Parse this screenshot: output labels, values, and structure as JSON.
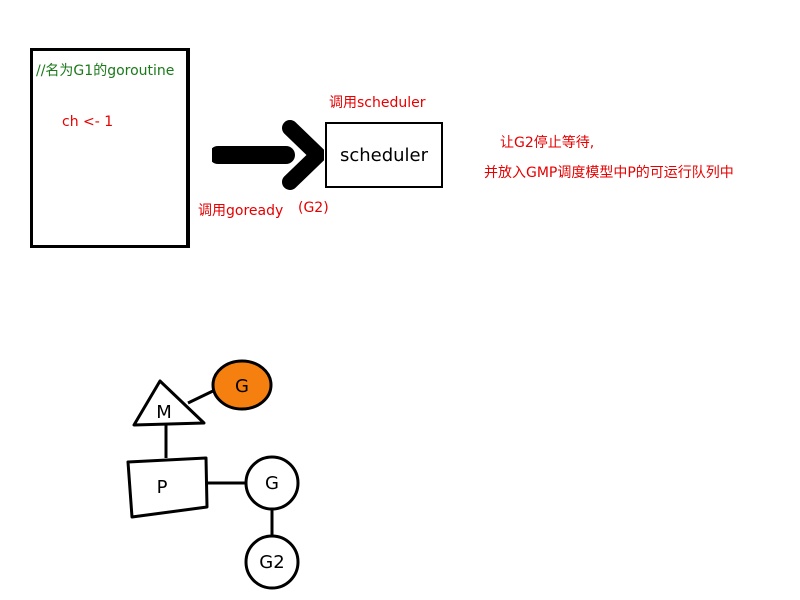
{
  "goroutine_box": {
    "comment": "//名为G1的goroutine",
    "code": "ch <- 1"
  },
  "call_scheduler_label": "调用scheduler",
  "scheduler_box_label": "scheduler",
  "call_goready_label": "调用goready",
  "goready_arg": "(G2)",
  "note": {
    "line1": "让G2停止等待,",
    "line2": "并放入GMP调度模型中P的可运行队列中"
  },
  "gmp": {
    "m_label": "M",
    "running_g_label": "G",
    "p_label": "P",
    "queued_g_label": "G",
    "g2_label": "G2",
    "running_g_color": "#f5800f",
    "stroke_color": "#000000"
  },
  "colors": {
    "comment": "#1a7a1a",
    "annotation": "#e60000"
  }
}
